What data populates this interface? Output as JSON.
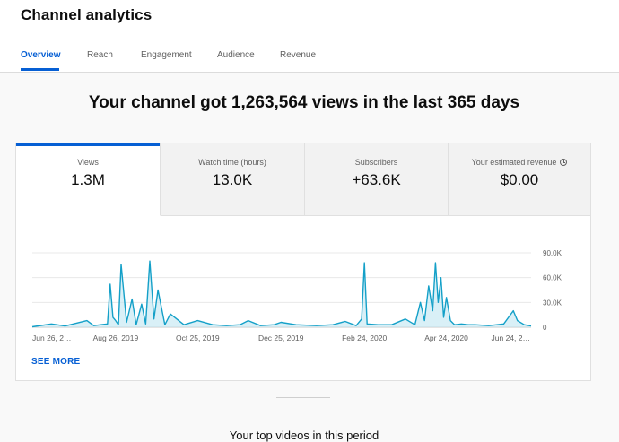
{
  "page": {
    "title": "Channel analytics"
  },
  "tabs": [
    {
      "label": "Overview",
      "active": true
    },
    {
      "label": "Reach"
    },
    {
      "label": "Engagement"
    },
    {
      "label": "Audience"
    },
    {
      "label": "Revenue"
    }
  ],
  "headline": "Your channel got 1,263,564 views in the last 365 days",
  "metrics": [
    {
      "label": "Views",
      "value": "1.3M",
      "active": true
    },
    {
      "label": "Watch time (hours)",
      "value": "13.0K"
    },
    {
      "label": "Subscribers",
      "value": "+63.6K"
    },
    {
      "label": "Your estimated revenue",
      "value": "$0.00",
      "icon": "info-icon"
    }
  ],
  "see_more": "SEE MORE",
  "section_title": "Your top videos in this period",
  "colors": {
    "accent": "#065fd4",
    "line": "#14a0c8",
    "fill": "#bfe6f1"
  },
  "chart_data": {
    "type": "area",
    "x_tick_labels": [
      "Jun 26, 2…",
      "Aug 26, 2019",
      "Oct 25, 2019",
      "Dec 25, 2019",
      "Feb 24, 2020",
      "Apr 24, 2020",
      "Jun 24, 2…"
    ],
    "y_tick_labels": [
      "90.0K",
      "60.0K",
      "30.0K",
      "0"
    ],
    "ylim": [
      0,
      90000
    ],
    "grid": true,
    "x": [
      "2019-06-26",
      "2019-07-10",
      "2019-07-20",
      "2019-08-05",
      "2019-08-10",
      "2019-08-15",
      "2019-08-20",
      "2019-08-22",
      "2019-08-24",
      "2019-08-26",
      "2019-08-28",
      "2019-08-30",
      "2019-09-03",
      "2019-09-07",
      "2019-09-10",
      "2019-09-14",
      "2019-09-17",
      "2019-09-20",
      "2019-09-23",
      "2019-09-26",
      "2019-10-01",
      "2019-10-05",
      "2019-10-15",
      "2019-10-25",
      "2019-11-05",
      "2019-11-15",
      "2019-11-25",
      "2019-12-01",
      "2019-12-10",
      "2019-12-20",
      "2019-12-25",
      "2020-01-05",
      "2020-01-20",
      "2020-02-01",
      "2020-02-10",
      "2020-02-18",
      "2020-02-22",
      "2020-02-24",
      "2020-02-26",
      "2020-03-05",
      "2020-03-15",
      "2020-03-25",
      "2020-04-01",
      "2020-04-05",
      "2020-04-08",
      "2020-04-11",
      "2020-04-14",
      "2020-04-16",
      "2020-04-18",
      "2020-04-20",
      "2020-04-22",
      "2020-04-24",
      "2020-04-27",
      "2020-04-30",
      "2020-05-05",
      "2020-05-10",
      "2020-05-15",
      "2020-05-25",
      "2020-06-05",
      "2020-06-12",
      "2020-06-15",
      "2020-06-20",
      "2020-06-25"
    ],
    "values": [
      500,
      4000,
      1500,
      8000,
      2000,
      3000,
      4000,
      52000,
      12000,
      8000,
      3000,
      76000,
      6000,
      34000,
      3000,
      28000,
      4000,
      80000,
      10000,
      45000,
      3000,
      16000,
      3000,
      8000,
      3000,
      2000,
      3000,
      8000,
      2000,
      3000,
      6000,
      3000,
      2000,
      3000,
      7000,
      2000,
      10000,
      78000,
      4000,
      3000,
      3000,
      10000,
      3000,
      30000,
      8000,
      50000,
      20000,
      78000,
      30000,
      60000,
      12000,
      36000,
      8000,
      3000,
      4000,
      3000,
      3000,
      2000,
      4000,
      20000,
      8000,
      3000,
      1500
    ]
  }
}
